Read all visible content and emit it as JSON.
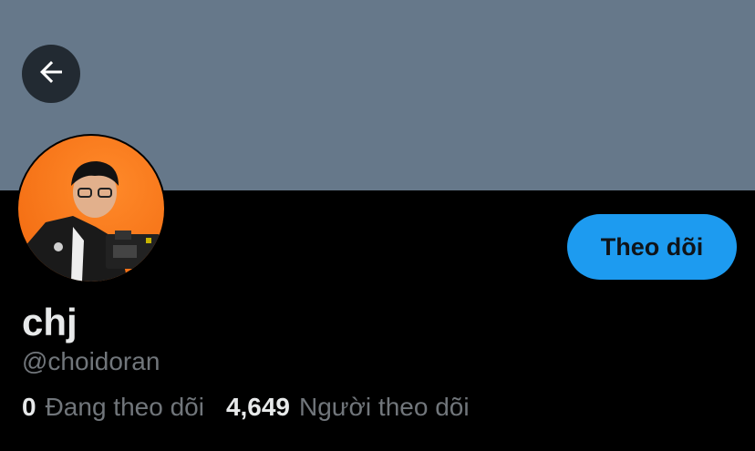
{
  "banner": {
    "color": "#66788a"
  },
  "back_button": {
    "icon": "arrow-left-icon"
  },
  "avatar": {
    "background": "#ff7a1f",
    "alt": "Profile photo"
  },
  "follow_button": {
    "label": "Theo dõi",
    "color": "#1d9bf0"
  },
  "profile": {
    "display_name": "chj",
    "handle": "@choidoran"
  },
  "stats": {
    "following_count": "0",
    "following_label": "Đang theo dõi",
    "followers_count": "4,649",
    "followers_label": "Người theo dõi"
  }
}
